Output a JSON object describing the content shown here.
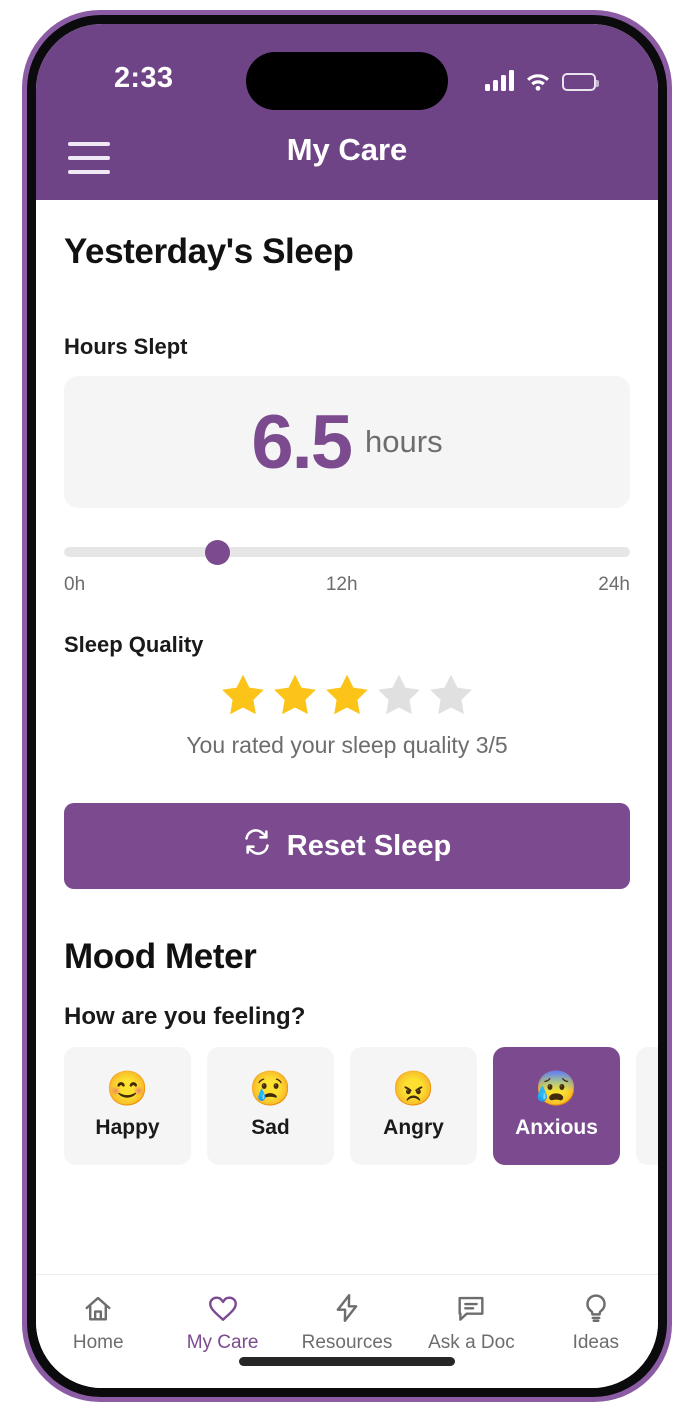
{
  "theme": {
    "header_purple": "#6f4486",
    "accent_purple": "#7b4a8f",
    "star_gold": "#fcc419",
    "star_empty": "#e0e0e0",
    "card_gray": "#f5f5f5",
    "muted_text": "#6d6d6d",
    "frame_band": "#8b5ba3"
  },
  "status_bar": {
    "time": "2:33",
    "signal_icon": "cellular-signal-icon",
    "wifi_icon": "wifi-icon",
    "battery_icon": "battery-full-icon"
  },
  "header": {
    "menu_icon": "hamburger-menu-icon",
    "title": "My Care"
  },
  "sleep": {
    "title": "Yesterday's Sleep",
    "hours_label": "Hours Slept",
    "hours_value": "6.5",
    "hours_unit": "hours",
    "slider": {
      "min_label": "0h",
      "mid_label": "12h",
      "max_label": "24h",
      "min": 0,
      "max": 24,
      "value": 6.5,
      "percent": 27
    },
    "quality_label": "Sleep Quality",
    "stars_filled": 3,
    "stars_total": 5,
    "rating_caption": "You rated your sleep quality 3/5",
    "reset_button": {
      "label": "Reset Sleep",
      "icon": "refresh-icon"
    }
  },
  "mood": {
    "title": "Mood Meter",
    "question": "How are you feeling?",
    "options": [
      {
        "name": "Happy",
        "emoji": "😊",
        "icon": "smiling-face-icon",
        "selected": false
      },
      {
        "name": "Sad",
        "emoji": "😢",
        "icon": "crying-face-icon",
        "selected": false
      },
      {
        "name": "Angry",
        "emoji": "😠",
        "icon": "angry-face-icon",
        "selected": false
      },
      {
        "name": "Anxious",
        "emoji": "😰",
        "icon": "anxious-sweat-face-icon",
        "selected": true
      },
      {
        "name": "",
        "emoji": "",
        "icon": "clipped-mood-chip",
        "selected": false
      }
    ]
  },
  "tab_bar": {
    "items": [
      {
        "label": "Home",
        "icon": "home-icon",
        "active": false
      },
      {
        "label": "My Care",
        "icon": "heart-icon",
        "active": true
      },
      {
        "label": "Resources",
        "icon": "lightning-icon",
        "active": false
      },
      {
        "label": "Ask a Doc",
        "icon": "chat-icon",
        "active": false
      },
      {
        "label": "Ideas",
        "icon": "lightbulb-icon",
        "active": false
      }
    ]
  }
}
